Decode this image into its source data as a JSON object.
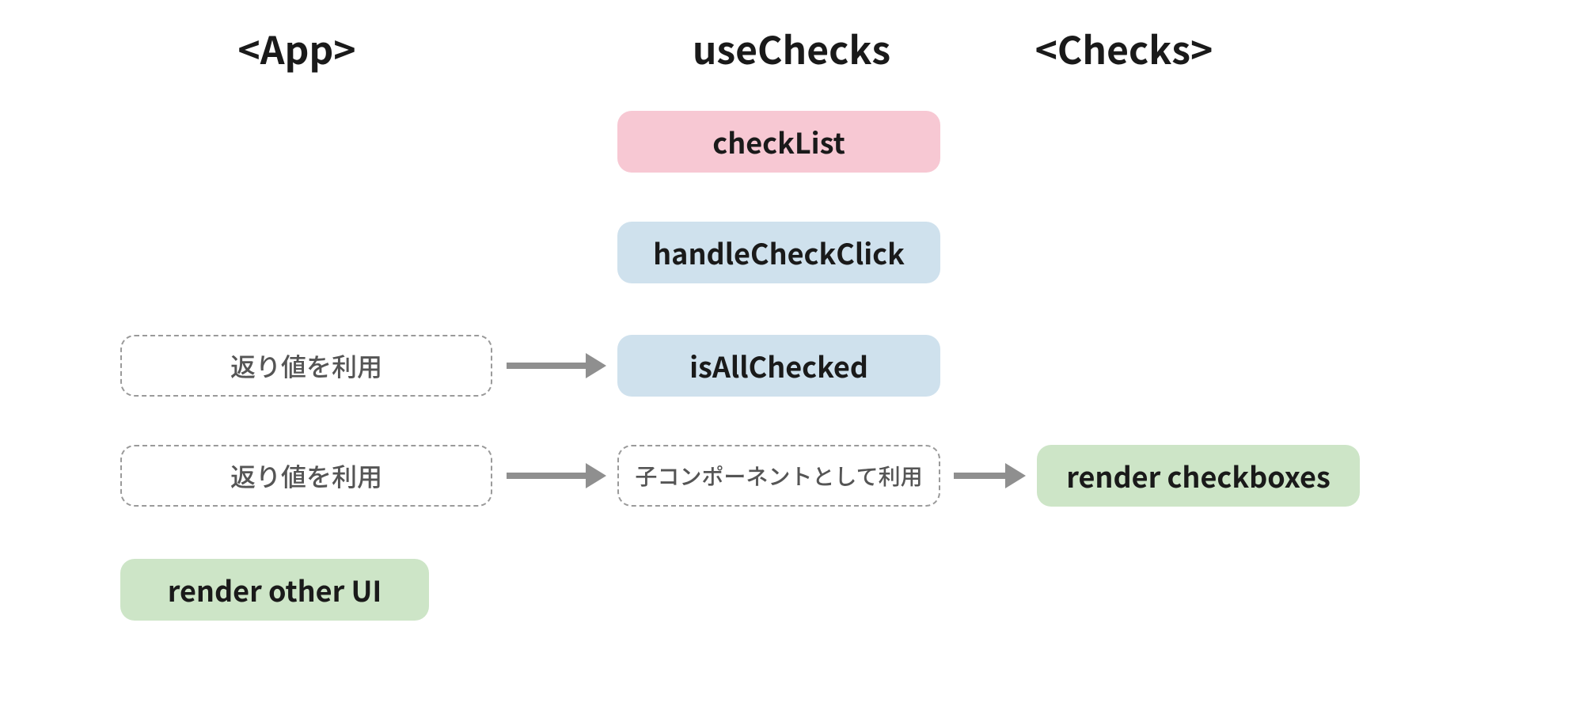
{
  "columns": {
    "app": "<App>",
    "useChecks": "useChecks",
    "checks": "<Checks>"
  },
  "nodes": {
    "checkList": "checkList",
    "handleCheckClick": "handleCheckClick",
    "isAllChecked": "isAllChecked",
    "renderCheckboxes": "render checkboxes",
    "renderOtherUI": "render other UI",
    "useReturn1": "返り値を利用",
    "useReturn2": "返り値を利用",
    "useAsChild": "子コンポーネントとして利用"
  },
  "colors": {
    "pink": "#f7c8d3",
    "blue": "#cfe1ed",
    "green": "#cde5c7",
    "arrow": "#8f8f8f",
    "dashedBorder": "#9a9a9a"
  }
}
